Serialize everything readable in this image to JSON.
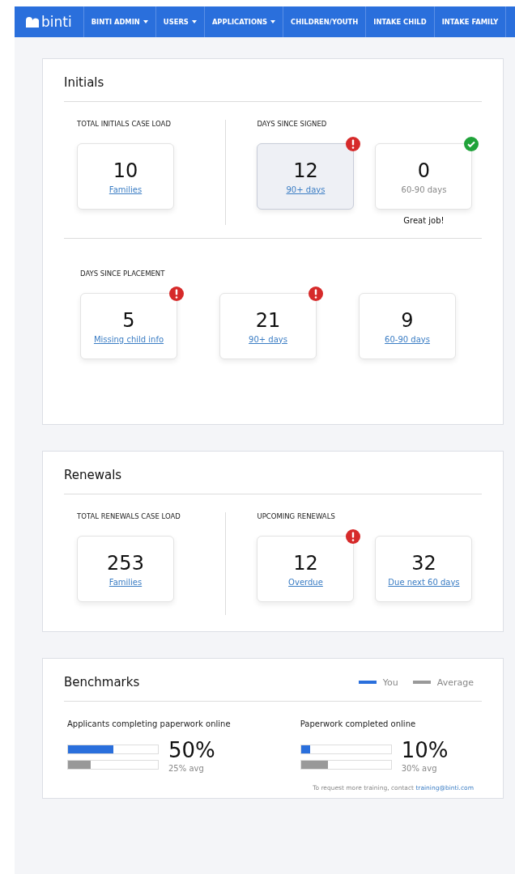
{
  "nav": {
    "logo": "binti",
    "items": [
      {
        "label": "BINTI ADMIN",
        "dropdown": true
      },
      {
        "label": "USERS",
        "dropdown": true
      },
      {
        "label": "APPLICATIONS",
        "dropdown": true
      },
      {
        "label": "CHILDREN/YOUTH",
        "dropdown": false
      },
      {
        "label": "INTAKE CHILD",
        "dropdown": false
      },
      {
        "label": "INTAKE FAMILY",
        "dropdown": false
      }
    ]
  },
  "initials": {
    "title": "Initials",
    "groups": [
      {
        "heading": "TOTAL INITIALS  CASE LOAD",
        "stats": [
          {
            "count": "10",
            "label": "Families",
            "link": true,
            "highlighted": false,
            "warning": false,
            "complete": false
          }
        ]
      },
      {
        "heading": "DAYS SINCE SIGNED",
        "stats": [
          {
            "count": "12",
            "label": "90+ days",
            "link": true,
            "highlighted": true,
            "warning": true,
            "complete": false
          },
          {
            "count": "0",
            "label": "60-90 days",
            "link": false,
            "highlighted": false,
            "warning": false,
            "complete": true,
            "note": "Great job!"
          }
        ]
      }
    ],
    "placement": {
      "heading": "DAYS SINCE PLACEMENT",
      "stats": [
        {
          "count": "5",
          "label": "Missing child info",
          "link": true,
          "highlighted": false,
          "warning": true,
          "complete": false
        },
        {
          "count": "21",
          "label": "90+ days",
          "link": true,
          "highlighted": false,
          "warning": true,
          "complete": false
        },
        {
          "count": "9",
          "label": "60-90 days",
          "link": true,
          "highlighted": false,
          "warning": false,
          "complete": false
        }
      ]
    }
  },
  "renewals": {
    "title": "Renewals",
    "groups": [
      {
        "heading": "TOTAL RENEWALS CASE LOAD",
        "stats": [
          {
            "count": "253",
            "label": "Families",
            "link": true,
            "highlighted": false,
            "warning": false,
            "complete": false
          }
        ]
      },
      {
        "heading": "UPCOMING RENEWALS",
        "stats": [
          {
            "count": "12",
            "label": "Overdue",
            "link": true,
            "highlighted": false,
            "warning": true,
            "complete": false
          },
          {
            "count": "32",
            "label": "Due next 60 days",
            "link": true,
            "highlighted": false,
            "warning": false,
            "complete": false
          }
        ]
      }
    ]
  },
  "benchmarks": {
    "title": "Benchmarks",
    "legend": [
      {
        "label": "You",
        "color": "#2a6fdc"
      },
      {
        "label": "Average",
        "color": "#999999"
      }
    ],
    "metrics": [
      {
        "title": "Applicants completing paperwork online",
        "bars": [
          {
            "kind": "you",
            "level": 0.5
          },
          {
            "kind": "average",
            "level": 0.25
          }
        ],
        "value": "50%",
        "avg": "25% avg"
      },
      {
        "title": "Paperwork completed online",
        "bars": [
          {
            "kind": "you",
            "level": 0.1
          },
          {
            "kind": "average",
            "level": 0.3
          }
        ],
        "value": "10%",
        "avg": "30% avg"
      }
    ],
    "footer": "To request more training, contact ",
    "email": "training@binti.com"
  }
}
